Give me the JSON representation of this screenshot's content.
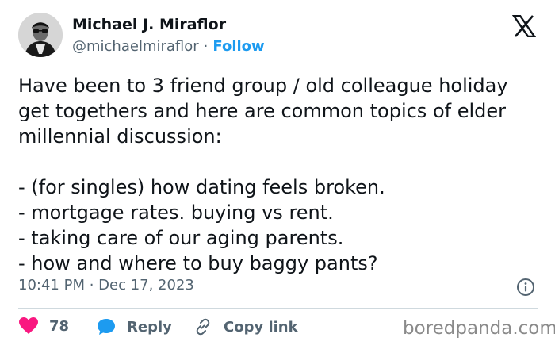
{
  "author": {
    "name": "Michael J. Miraflor",
    "handle": "@michaelmiraflor",
    "separator": "·",
    "follow_label": "Follow"
  },
  "tweet": {
    "text": "Have been to 3 friend group / old colleague holiday get togethers and here are common topics of elder millennial discussion:\n\n- (for singles) how dating feels broken.\n- mortgage rates. buying vs rent.\n- taking care of our aging parents.\n- how and where to buy baggy pants?",
    "timestamp": "10:41 PM · Dec 17, 2023"
  },
  "actions": {
    "like_count": "78",
    "reply_label": "Reply",
    "copy_link_label": "Copy link"
  },
  "watermark": "boredpanda.com",
  "icons": {
    "logo": "x-logo-icon",
    "info": "info-icon",
    "like": "heart-icon",
    "reply": "speech-bubble-icon",
    "copy_link": "link-icon"
  },
  "colors": {
    "follow": "#1d9bf0",
    "like": "#f91880",
    "reply": "#1d9bf0",
    "muted": "#536471",
    "text": "#0f1419"
  }
}
